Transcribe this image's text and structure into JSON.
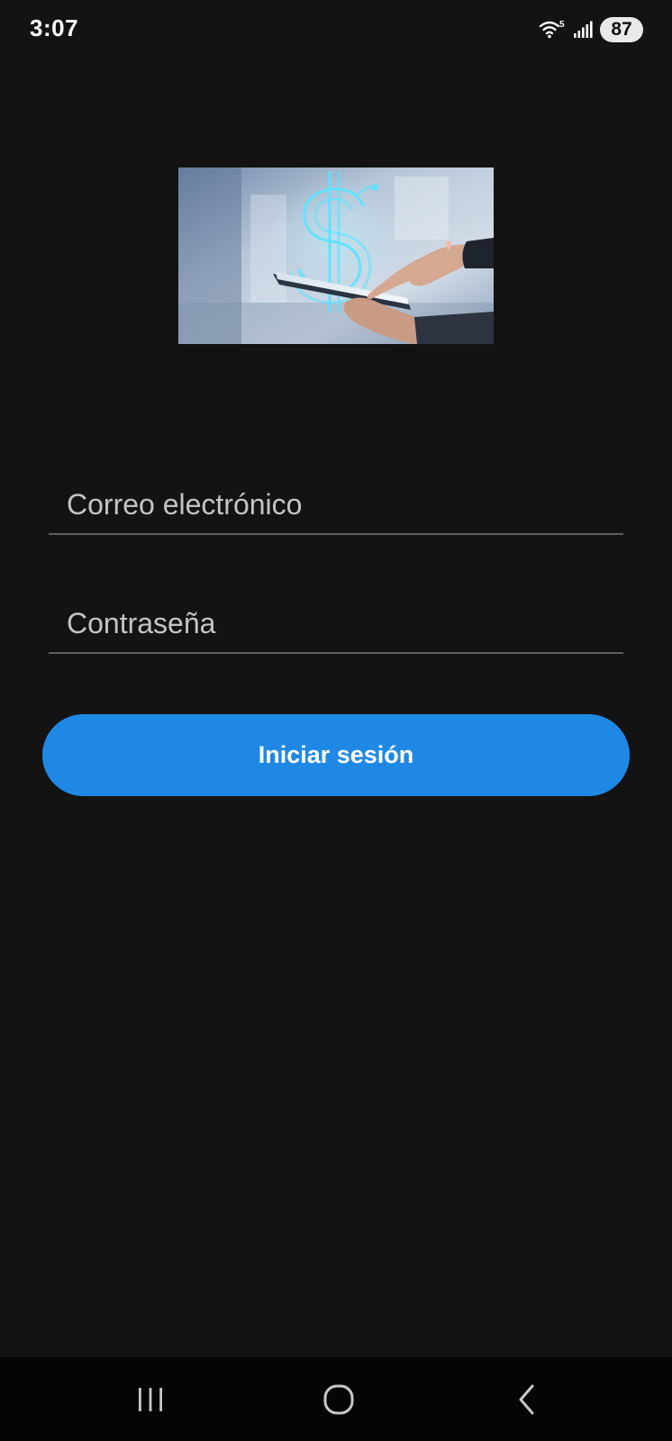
{
  "status_bar": {
    "time": "3:07",
    "wifi_label": "5",
    "battery": "87",
    "icons": [
      "wifi-icon",
      "signal-icon",
      "battery-icon"
    ]
  },
  "hero": {
    "image": "finance-dollar-tablet-image"
  },
  "login_form": {
    "email_placeholder": "Correo electrónico",
    "email_value": "",
    "password_placeholder": "Contraseña",
    "password_value": "",
    "submit_label": "Iniciar sesión"
  },
  "nav_bar": {
    "icons": [
      "recents-icon",
      "home-icon",
      "back-icon"
    ]
  },
  "colors": {
    "background": "#131313",
    "accent": "#1f88e5",
    "nav_background": "#050505",
    "field_underline": "#5e5e5e"
  }
}
